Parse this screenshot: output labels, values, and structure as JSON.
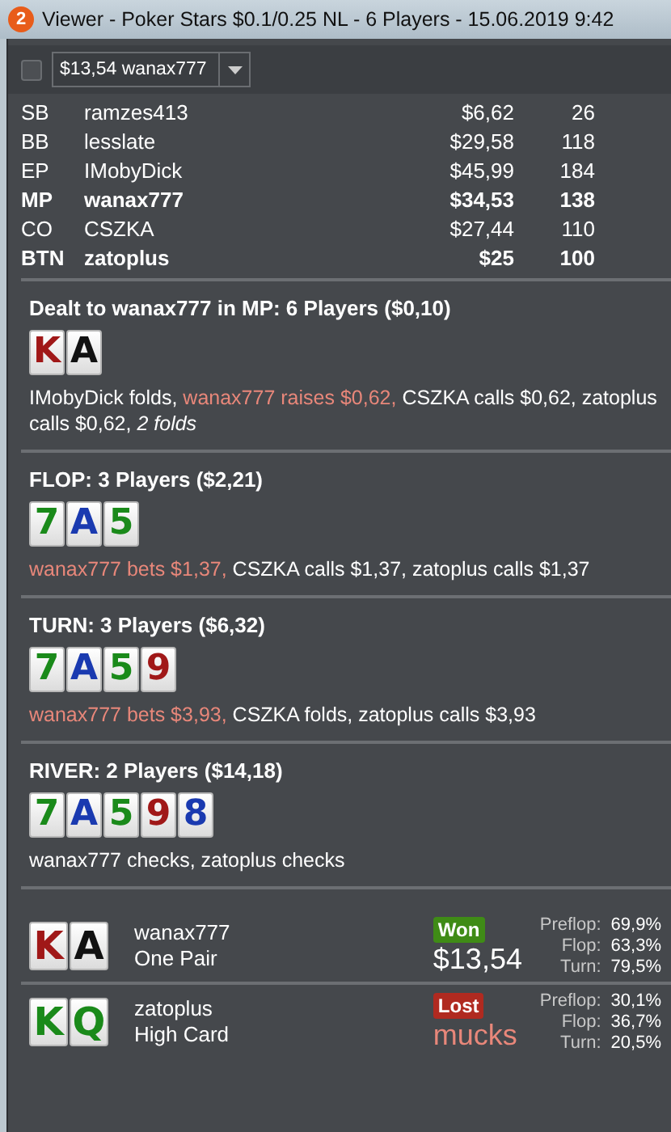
{
  "window": {
    "badge": "2",
    "title": "Viewer - Poker Stars $0.1/0.25 NL - 6 Players - 15.06.2019 9:42"
  },
  "toolbar": {
    "checkbox": {
      "checked": false
    },
    "hand_select": {
      "value": "$13,54 wanax777"
    }
  },
  "players": [
    {
      "position": "SB",
      "name": "ramzes413",
      "stack": "$6,62",
      "bb": "26",
      "hero_or_button": false
    },
    {
      "position": "BB",
      "name": "lesslate",
      "stack": "$29,58",
      "bb": "118",
      "hero_or_button": false
    },
    {
      "position": "EP",
      "name": "IMobyDick",
      "stack": "$45,99",
      "bb": "184",
      "hero_or_button": false
    },
    {
      "position": "MP",
      "name": "wanax777",
      "stack": "$34,53",
      "bb": "138",
      "hero_or_button": true
    },
    {
      "position": "CO",
      "name": "CSZKA",
      "stack": "$27,44",
      "bb": "110",
      "hero_or_button": false
    },
    {
      "position": "BTN",
      "name": "zatoplus",
      "stack": "$25",
      "bb": "100",
      "hero_or_button": true
    }
  ],
  "streets": [
    {
      "header": "Dealt to wanax777 in MP: 6 Players ($0,10)",
      "cards": [
        {
          "rank": "K",
          "color": "#a01818"
        },
        {
          "rank": "A",
          "color": "#111111"
        }
      ],
      "actions": [
        {
          "text": "IMobyDick folds, ",
          "kind": "normal"
        },
        {
          "text": "wanax777 raises $0,62, ",
          "kind": "hero"
        },
        {
          "text": "CSZKA calls $0,62, zatoplus calls $0,62, ",
          "kind": "normal"
        },
        {
          "text": "2 folds",
          "kind": "summary"
        }
      ]
    },
    {
      "header": "FLOP: 3 Players ($2,21)",
      "cards": [
        {
          "rank": "7",
          "color": "#1a8a1a"
        },
        {
          "rank": "A",
          "color": "#1a3ab0"
        },
        {
          "rank": "5",
          "color": "#1a8a1a"
        }
      ],
      "actions": [
        {
          "text": "wanax777 bets $1,37, ",
          "kind": "hero"
        },
        {
          "text": "CSZKA calls $1,37, zatoplus calls $1,37",
          "kind": "normal"
        }
      ]
    },
    {
      "header": "TURN: 3 Players ($6,32)",
      "cards": [
        {
          "rank": "7",
          "color": "#1a8a1a"
        },
        {
          "rank": "A",
          "color": "#1a3ab0"
        },
        {
          "rank": "5",
          "color": "#1a8a1a"
        },
        {
          "rank": "9",
          "color": "#a01818"
        }
      ],
      "actions": [
        {
          "text": "wanax777 bets $3,93, ",
          "kind": "hero"
        },
        {
          "text": "CSZKA folds, zatoplus calls $3,93",
          "kind": "normal"
        }
      ]
    },
    {
      "header": "RIVER: 2 Players ($14,18)",
      "cards": [
        {
          "rank": "7",
          "color": "#1a8a1a"
        },
        {
          "rank": "A",
          "color": "#1a3ab0"
        },
        {
          "rank": "5",
          "color": "#1a8a1a"
        },
        {
          "rank": "9",
          "color": "#a01818"
        },
        {
          "rank": "8",
          "color": "#1a3ab0"
        }
      ],
      "actions": [
        {
          "text": "wanax777 checks, zatoplus checks",
          "kind": "normal"
        }
      ]
    }
  ],
  "results": [
    {
      "cards": [
        {
          "rank": "K",
          "color": "#a01818"
        },
        {
          "rank": "A",
          "color": "#111111"
        }
      ],
      "name": "wanax777",
      "hand": "One Pair",
      "kind": "won",
      "badge": "Won",
      "amount": "$13,54",
      "equity": [
        {
          "label": "Preflop:",
          "value": "69,9%"
        },
        {
          "label": "Flop:",
          "value": "63,3%"
        },
        {
          "label": "Turn:",
          "value": "79,5%"
        }
      ]
    },
    {
      "cards": [
        {
          "rank": "K",
          "color": "#1a8a1a"
        },
        {
          "rank": "Q",
          "color": "#1a8a1a"
        }
      ],
      "name": "zatoplus",
      "hand": "High Card",
      "kind": "lost",
      "badge": "Lost",
      "amount": "mucks",
      "equity": [
        {
          "label": "Preflop:",
          "value": "30,1%"
        },
        {
          "label": "Flop:",
          "value": "36,7%"
        },
        {
          "label": "Turn:",
          "value": "20,5%"
        }
      ]
    }
  ]
}
